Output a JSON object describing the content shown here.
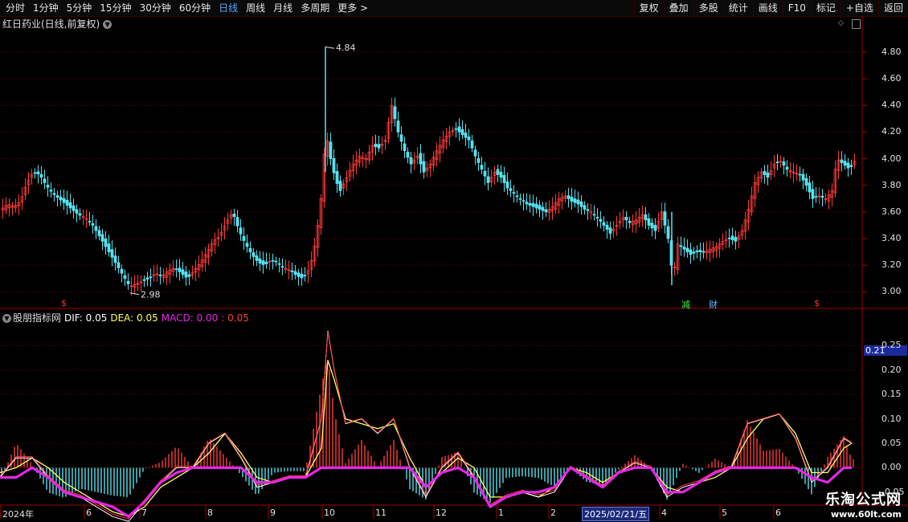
{
  "toolbar": {
    "left": [
      "分时",
      "1分钟",
      "5分钟",
      "15分钟",
      "30分钟",
      "60分钟",
      "日线",
      "周线",
      "月线",
      "多周期",
      "更多 >"
    ],
    "active": "日线",
    "right": [
      "复权",
      "叠加",
      "多股",
      "统计",
      "画线",
      "F10",
      "标记",
      "+自选",
      "返回"
    ]
  },
  "title": "红日药业(日线,前复权)",
  "indicator": {
    "name": "股朋指标网",
    "dif_label": "DIF: 0.05",
    "dea_label": "DEA: 0.05",
    "macd_label": "MACD: 0.00",
    "extra_label": ": 0.05"
  },
  "price_axis": [
    "4.80",
    "4.60",
    "4.40",
    "4.20",
    "4.00",
    "3.80",
    "3.60",
    "3.40",
    "3.20",
    "3.00"
  ],
  "macd_axis": [
    "0.25",
    "0.20",
    "0.15",
    "0.10",
    "0.05",
    "0.00",
    "-0.05"
  ],
  "current_value": "0.21",
  "annotations": {
    "high": "4.84",
    "low": "2.98"
  },
  "markers": [
    {
      "text": "$",
      "color": "#ff3333"
    },
    {
      "text": "减",
      "color": "#33ff33"
    },
    {
      "text": "财",
      "color": "#66bbff"
    },
    {
      "text": "$",
      "color": "#ff3333"
    }
  ],
  "x_labels": [
    "2024年",
    "6",
    "7",
    "8",
    "9",
    "10",
    "11",
    "12",
    "1",
    "2",
    "4",
    "5",
    "6"
  ],
  "date_box": "2025/02/21/五",
  "watermark": {
    "line1": "乐淘公式网",
    "line2": "www.60lt.com"
  },
  "colors": {
    "up": "#ff3b3b",
    "down": "#54e2f0",
    "dea": "#ffff66",
    "dif": "#ffffff",
    "macd_line": "#e626e6",
    "grid": "#7a0000"
  },
  "chart_data": {
    "type": "candlestick",
    "close_path": [
      [
        0,
        3.62
      ],
      [
        8,
        3.66
      ],
      [
        16,
        3.64
      ],
      [
        24,
        3.68
      ],
      [
        32,
        3.82
      ],
      [
        40,
        3.9
      ],
      [
        48,
        3.88
      ],
      [
        56,
        3.8
      ],
      [
        64,
        3.74
      ],
      [
        72,
        3.7
      ],
      [
        80,
        3.66
      ],
      [
        88,
        3.62
      ],
      [
        96,
        3.58
      ],
      [
        104,
        3.56
      ],
      [
        112,
        3.52
      ],
      [
        120,
        3.44
      ],
      [
        128,
        3.36
      ],
      [
        136,
        3.28
      ],
      [
        144,
        3.2
      ],
      [
        152,
        3.12
      ],
      [
        160,
        3.04
      ],
      [
        168,
        3.06
      ],
      [
        176,
        3.08
      ],
      [
        184,
        3.1
      ],
      [
        192,
        3.14
      ],
      [
        200,
        3.12
      ],
      [
        208,
        3.16
      ],
      [
        216,
        3.18
      ],
      [
        224,
        3.14
      ],
      [
        232,
        3.1
      ],
      [
        240,
        3.16
      ],
      [
        248,
        3.22
      ],
      [
        256,
        3.3
      ],
      [
        264,
        3.38
      ],
      [
        272,
        3.42
      ],
      [
        280,
        3.52
      ],
      [
        288,
        3.6
      ],
      [
        296,
        3.46
      ],
      [
        304,
        3.36
      ],
      [
        312,
        3.28
      ],
      [
        320,
        3.22
      ],
      [
        328,
        3.2
      ],
      [
        336,
        3.24
      ],
      [
        344,
        3.22
      ],
      [
        352,
        3.18
      ],
      [
        360,
        3.16
      ],
      [
        368,
        3.12
      ],
      [
        376,
        3.1
      ],
      [
        384,
        3.18
      ],
      [
        392,
        3.4
      ],
      [
        398,
        3.7
      ],
      [
        404,
        4.2
      ],
      [
        410,
        4.0
      ],
      [
        416,
        3.84
      ],
      [
        422,
        3.76
      ],
      [
        430,
        3.86
      ],
      [
        438,
        3.96
      ],
      [
        446,
        4.02
      ],
      [
        454,
        4.0
      ],
      [
        462,
        4.1
      ],
      [
        470,
        4.08
      ],
      [
        478,
        4.14
      ],
      [
        486,
        4.4
      ],
      [
        494,
        4.2
      ],
      [
        502,
        4.06
      ],
      [
        510,
        3.96
      ],
      [
        518,
        4.02
      ],
      [
        526,
        3.9
      ],
      [
        534,
        3.96
      ],
      [
        542,
        4.06
      ],
      [
        550,
        4.14
      ],
      [
        558,
        4.2
      ],
      [
        566,
        4.22
      ],
      [
        574,
        4.18
      ],
      [
        582,
        4.14
      ],
      [
        590,
        4.02
      ],
      [
        598,
        3.92
      ],
      [
        606,
        3.82
      ],
      [
        614,
        3.9
      ],
      [
        622,
        3.86
      ],
      [
        630,
        3.78
      ],
      [
        638,
        3.74
      ],
      [
        646,
        3.7
      ],
      [
        654,
        3.66
      ],
      [
        662,
        3.64
      ],
      [
        670,
        3.62
      ],
      [
        678,
        3.6
      ],
      [
        686,
        3.64
      ],
      [
        694,
        3.7
      ],
      [
        702,
        3.72
      ],
      [
        710,
        3.68
      ],
      [
        718,
        3.66
      ],
      [
        726,
        3.62
      ],
      [
        734,
        3.6
      ],
      [
        742,
        3.56
      ],
      [
        750,
        3.5
      ],
      [
        758,
        3.44
      ],
      [
        766,
        3.5
      ],
      [
        774,
        3.56
      ],
      [
        782,
        3.52
      ],
      [
        790,
        3.54
      ],
      [
        798,
        3.58
      ],
      [
        806,
        3.5
      ],
      [
        814,
        3.46
      ],
      [
        822,
        3.6
      ],
      [
        830,
        3.4
      ],
      [
        836,
        3.1
      ],
      [
        842,
        3.36
      ],
      [
        850,
        3.32
      ],
      [
        858,
        3.28
      ],
      [
        866,
        3.3
      ],
      [
        874,
        3.3
      ],
      [
        882,
        3.32
      ],
      [
        890,
        3.34
      ],
      [
        898,
        3.38
      ],
      [
        906,
        3.4
      ],
      [
        914,
        3.38
      ],
      [
        922,
        3.46
      ],
      [
        930,
        3.62
      ],
      [
        938,
        3.82
      ],
      [
        946,
        3.9
      ],
      [
        954,
        3.86
      ],
      [
        962,
        3.96
      ],
      [
        970,
        3.98
      ],
      [
        978,
        3.92
      ],
      [
        986,
        3.9
      ],
      [
        994,
        3.88
      ],
      [
        1002,
        3.8
      ],
      [
        1010,
        3.7
      ],
      [
        1018,
        3.72
      ],
      [
        1026,
        3.7
      ],
      [
        1034,
        3.76
      ],
      [
        1040,
        4.0
      ],
      [
        1048,
        3.96
      ],
      [
        1056,
        3.92
      ],
      [
        1062,
        3.98
      ]
    ],
    "macd_x": [
      0,
      20,
      40,
      60,
      80,
      100,
      120,
      140,
      160,
      180,
      200,
      220,
      240,
      260,
      280,
      300,
      320,
      340,
      360,
      380,
      400,
      408,
      416,
      430,
      450,
      470,
      490,
      510,
      530,
      550,
      570,
      590,
      610,
      630,
      650,
      670,
      690,
      710,
      730,
      750,
      770,
      790,
      810,
      830,
      850,
      870,
      890,
      910,
      930,
      950,
      970,
      990,
      1010,
      1030,
      1050,
      1060
    ],
    "dif": [
      -0.02,
      0.02,
      0.02,
      -0.02,
      -0.05,
      -0.06,
      -0.08,
      -0.1,
      -0.11,
      -0.07,
      -0.03,
      0.0,
      0.0,
      0.05,
      0.07,
      0.02,
      -0.04,
      -0.03,
      -0.02,
      -0.02,
      0.1,
      0.28,
      0.2,
      0.09,
      0.1,
      0.07,
      0.1,
      0.0,
      -0.06,
      0.0,
      0.03,
      -0.02,
      -0.08,
      -0.06,
      -0.05,
      -0.06,
      -0.05,
      0.0,
      -0.02,
      -0.04,
      -0.01,
      0.01,
      0.0,
      -0.06,
      -0.04,
      -0.03,
      -0.01,
      0.0,
      0.09,
      0.1,
      0.11,
      0.06,
      -0.03,
      0.0,
      0.06,
      0.05
    ],
    "dea": [
      -0.01,
      0.0,
      0.02,
      0.0,
      -0.03,
      -0.05,
      -0.07,
      -0.09,
      -0.1,
      -0.08,
      -0.04,
      -0.02,
      0.0,
      0.03,
      0.07,
      0.03,
      -0.02,
      -0.03,
      -0.02,
      -0.02,
      0.04,
      0.22,
      0.18,
      0.1,
      0.09,
      0.08,
      0.09,
      0.02,
      -0.04,
      -0.01,
      0.02,
      0.0,
      -0.06,
      -0.06,
      -0.05,
      -0.06,
      -0.04,
      0.0,
      -0.01,
      -0.03,
      -0.01,
      0.0,
      0.0,
      -0.04,
      -0.05,
      -0.03,
      -0.02,
      0.0,
      0.06,
      0.1,
      0.11,
      0.07,
      -0.01,
      -0.01,
      0.04,
      0.05
    ],
    "macd_line": [
      -0.02,
      -0.02,
      0.0,
      -0.02,
      -0.05,
      -0.06,
      -0.07,
      -0.08,
      -0.1,
      -0.07,
      -0.03,
      -0.01,
      0.0,
      0.0,
      0.0,
      0.0,
      -0.03,
      -0.03,
      -0.02,
      -0.02,
      0.0,
      0.0,
      0.0,
      0.0,
      0.0,
      0.0,
      0.0,
      0.0,
      -0.04,
      -0.01,
      0.0,
      -0.02,
      -0.08,
      -0.06,
      -0.05,
      -0.05,
      -0.04,
      0.0,
      -0.02,
      -0.04,
      -0.01,
      0.0,
      0.0,
      -0.05,
      -0.05,
      -0.03,
      -0.01,
      0.0,
      0.0,
      0.0,
      0.0,
      0.0,
      -0.02,
      -0.03,
      0.0,
      0.0
    ],
    "price_range": [
      2.9,
      4.95
    ],
    "macd_range": [
      -0.075,
      0.3
    ]
  }
}
